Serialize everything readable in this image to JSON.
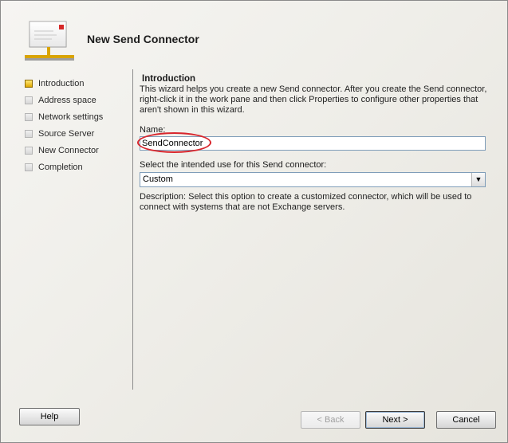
{
  "wizard": {
    "title": "New Send Connector",
    "icon": "send-connector-icon"
  },
  "steps": [
    {
      "label": "Introduction",
      "active": true
    },
    {
      "label": "Address space",
      "active": false
    },
    {
      "label": "Network settings",
      "active": false
    },
    {
      "label": "Source Server",
      "active": false
    },
    {
      "label": "New Connector",
      "active": false
    },
    {
      "label": "Completion",
      "active": false
    }
  ],
  "content": {
    "section_title": "Introduction",
    "intro_text": "This wizard helps you create a new Send connector. After you create the Send connector, right-click it in the work pane and then click Properties to configure other properties that aren't shown in this wizard.",
    "name_label": "Name:",
    "name_value": "SendConnector",
    "use_label": "Select the intended use for this Send connector:",
    "use_value": "Custom",
    "description": "Description: Select this option to create a customized connector, which will be used to connect with systems that are not Exchange servers."
  },
  "buttons": {
    "help": "Help",
    "back": "< Back",
    "next": "Next >",
    "cancel": "Cancel"
  },
  "colors": {
    "highlight_ellipse": "#d8262d",
    "active_step": "#e0a800"
  }
}
